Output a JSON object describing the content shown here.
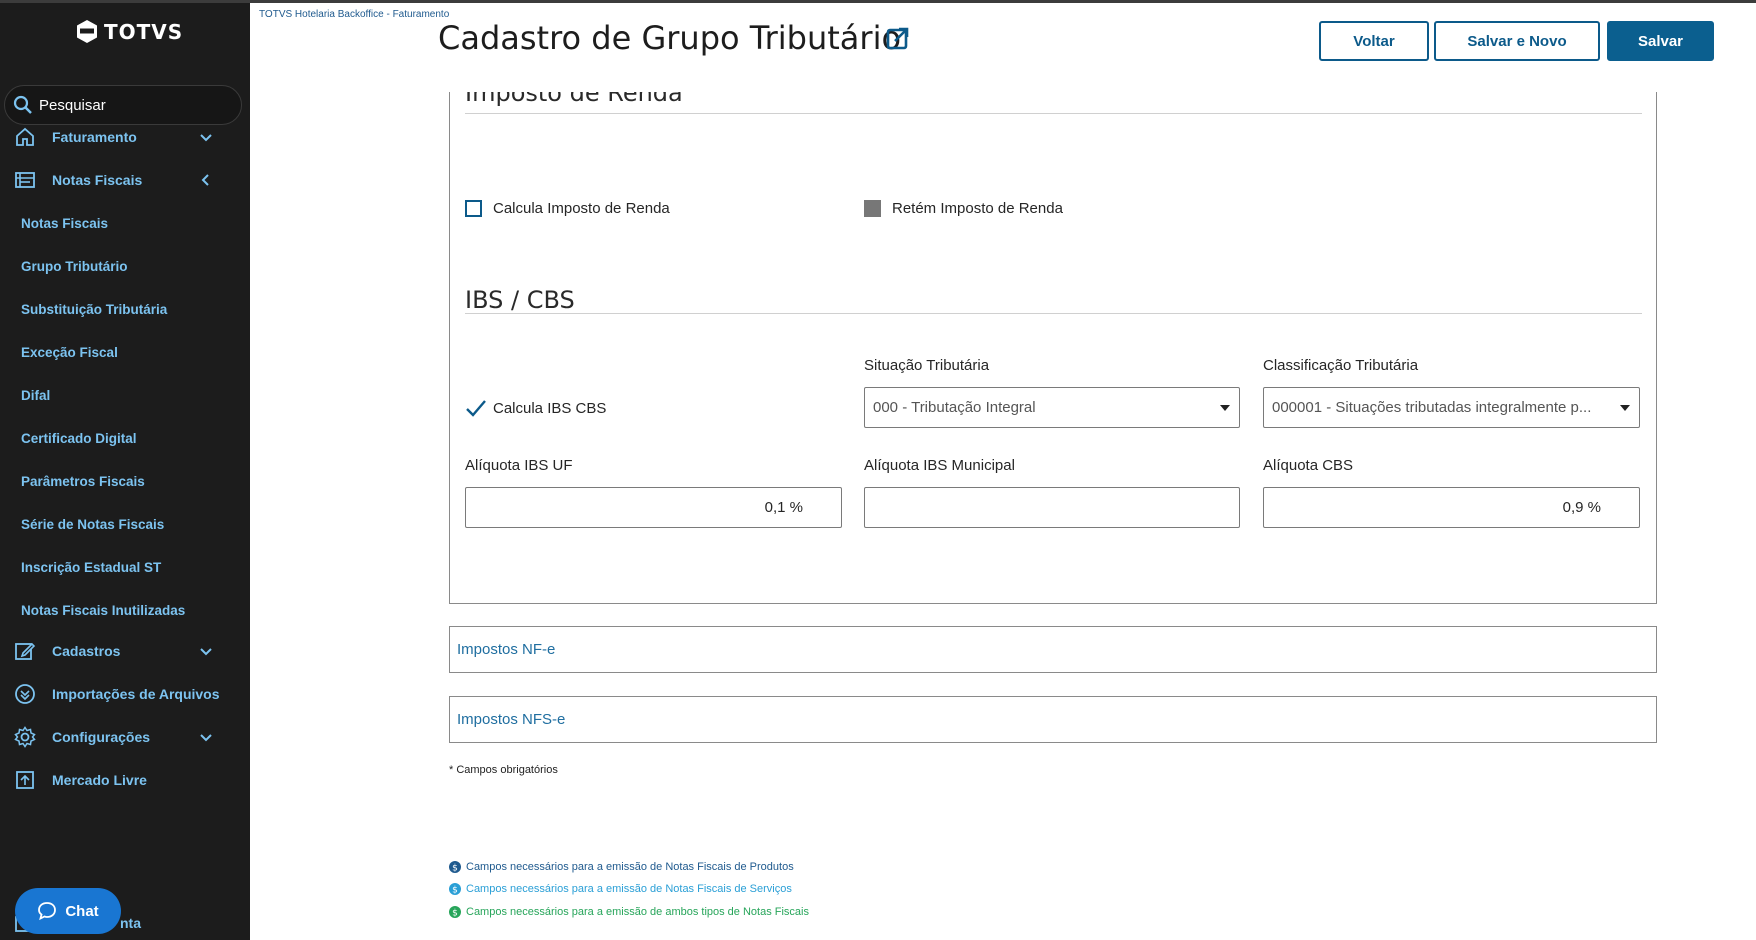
{
  "app": {
    "logo_text": "TOTVS"
  },
  "sidebar": {
    "search_placeholder": "Pesquisar",
    "items": [
      {
        "label": "Faturamento",
        "icon": "home-icon",
        "chevron": "down"
      },
      {
        "label": "Notas Fiscais",
        "icon": "invoice-icon",
        "chevron": "left"
      }
    ],
    "sub_items": [
      "Notas Fiscais",
      "Grupo Tributário",
      "Substituição Tributária",
      "Exceção Fiscal",
      "Difal",
      "Certificado Digital",
      "Parâmetros Fiscais",
      "Série de Notas Fiscais",
      "Inscrição Estadual ST",
      "Notas Fiscais Inutilizadas"
    ],
    "bottom_items": [
      {
        "label": "Cadastros",
        "icon": "edit-icon",
        "chevron": "down"
      },
      {
        "label": "Importações de Arquivos",
        "icon": "import-icon",
        "chevron": ""
      },
      {
        "label": "Configurações",
        "icon": "gear-icon",
        "chevron": "down"
      },
      {
        "label": "Mercado Livre",
        "icon": "upload-icon",
        "chevron": ""
      }
    ],
    "partial_item": "nta",
    "chat_label": "Chat"
  },
  "header": {
    "breadcrumb": "TOTVS Hotelaria Backoffice - Faturamento",
    "title": "Cadastro de Grupo Tributário",
    "buttons": {
      "back": "Voltar",
      "save_new": "Salvar e Novo",
      "save": "Salvar"
    }
  },
  "imposto_renda": {
    "title": "Imposto de Renda",
    "calcula_label": "Calcula Imposto de Renda",
    "calcula_checked": false,
    "retem_label": "Retém Imposto de Renda",
    "retem_checked": false
  },
  "ibs_cbs": {
    "title": "IBS / CBS",
    "calcula_label": "Calcula IBS CBS",
    "calcula_checked": true,
    "situacao_label": "Situação Tributária",
    "situacao_value": "000 - Tributação Integral",
    "classificacao_label": "Classificação Tributária",
    "classificacao_value": "000001 - Situações tributadas integralmente p...",
    "aliquota_uf_label": "Alíquota IBS UF",
    "aliquota_uf_value": "0,1 %",
    "aliquota_mun_label": "Alíquota IBS Municipal",
    "aliquota_mun_value": "",
    "aliquota_cbs_label": "Alíquota CBS",
    "aliquota_cbs_value": "0,9 %"
  },
  "sections": {
    "nfe": "Impostos NF-e",
    "nfse": "Impostos NFS-e"
  },
  "footer": {
    "required_note": "* Campos obrigatórios",
    "legend": [
      {
        "text": "Campos necessários para a emissão de Notas Fiscais de Produtos",
        "color": "#1f5a8e"
      },
      {
        "text": "Campos necessários para a emissão de Notas Fiscais de Serviços",
        "color": "#2a9fd6"
      },
      {
        "text": "Campos necessários para a emissão de ambos tipos de Notas Fiscais",
        "color": "#27a55a"
      }
    ]
  }
}
